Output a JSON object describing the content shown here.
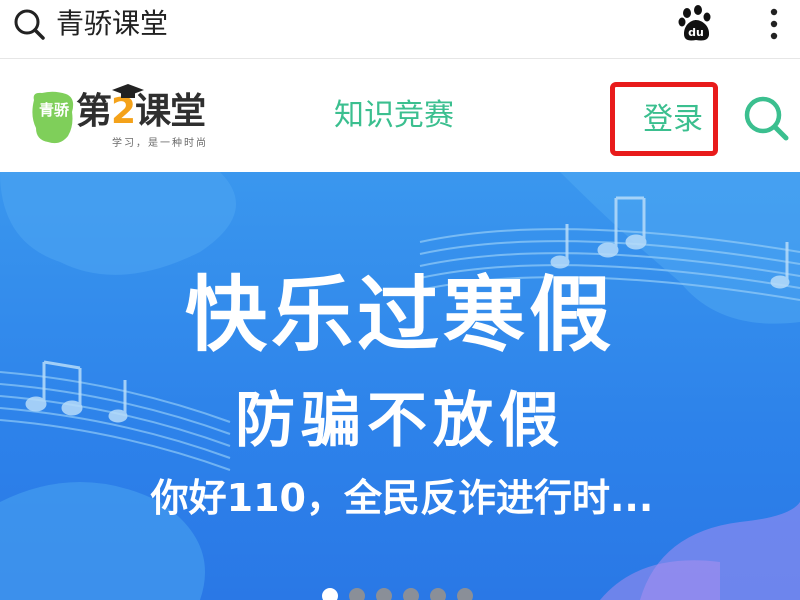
{
  "browser": {
    "query": "青骄课堂",
    "icons": {
      "search": "search-icon",
      "baidu": "baidu-paw-icon",
      "more": "more-vertical-icon"
    }
  },
  "site": {
    "logo": {
      "badge_text": "青骄",
      "name_part1": "第",
      "name_part2": "2",
      "name_part3": "课堂",
      "slogan": "学习，是一种时尚"
    },
    "nav": {
      "competition": "知识竞赛"
    },
    "login": "登录",
    "icons": {
      "search": "search-icon"
    },
    "colors": {
      "accent": "#3bbf8f",
      "highlight_box": "#e81b1b"
    }
  },
  "banner": {
    "headline": "快乐过寒假",
    "subhead": "防骗不放假",
    "tagline": "你好110，全民反诈进行时...",
    "carousel": {
      "count": 6,
      "active_index": 0
    },
    "colors": {
      "background": "#2d82ea"
    }
  }
}
